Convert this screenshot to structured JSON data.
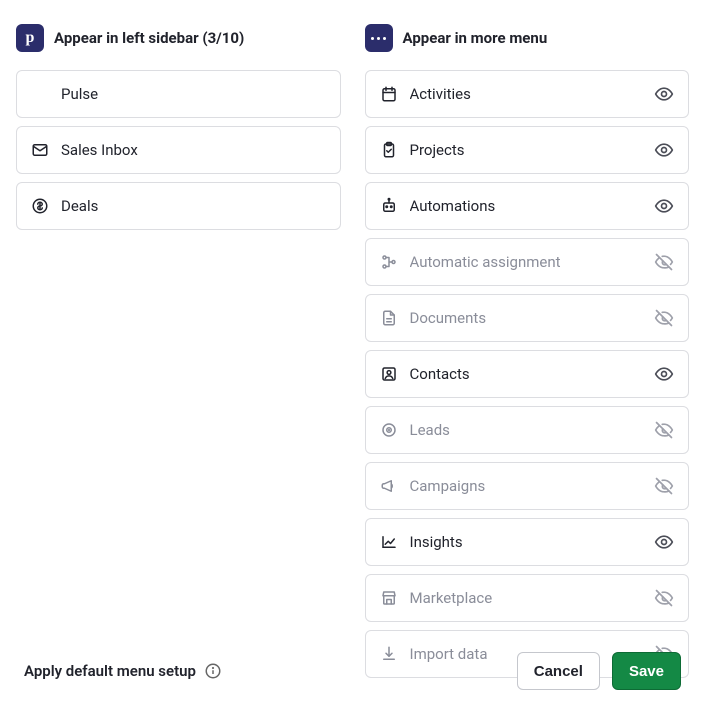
{
  "left": {
    "title": "Appear in left sidebar (3/10)",
    "items": [
      {
        "label": "Pulse",
        "icon": "",
        "visible": true
      },
      {
        "label": "Sales Inbox",
        "icon": "mail",
        "visible": true
      },
      {
        "label": "Deals",
        "icon": "currency",
        "visible": true
      }
    ]
  },
  "right": {
    "title": "Appear in more menu",
    "items": [
      {
        "label": "Activities",
        "icon": "calendar",
        "visible": true
      },
      {
        "label": "Projects",
        "icon": "clipboard",
        "visible": true
      },
      {
        "label": "Automations",
        "icon": "robot",
        "visible": true
      },
      {
        "label": "Automatic assignment",
        "icon": "sitemap",
        "visible": false
      },
      {
        "label": "Documents",
        "icon": "file",
        "visible": false
      },
      {
        "label": "Contacts",
        "icon": "contacts",
        "visible": true
      },
      {
        "label": "Leads",
        "icon": "target",
        "visible": false
      },
      {
        "label": "Campaigns",
        "icon": "megaphone",
        "visible": false
      },
      {
        "label": "Insights",
        "icon": "chart",
        "visible": true
      },
      {
        "label": "Marketplace",
        "icon": "store",
        "visible": false
      },
      {
        "label": "Import data",
        "icon": "import",
        "visible": false
      }
    ]
  },
  "footer": {
    "apply_default": "Apply default menu setup",
    "cancel": "Cancel",
    "save": "Save"
  }
}
